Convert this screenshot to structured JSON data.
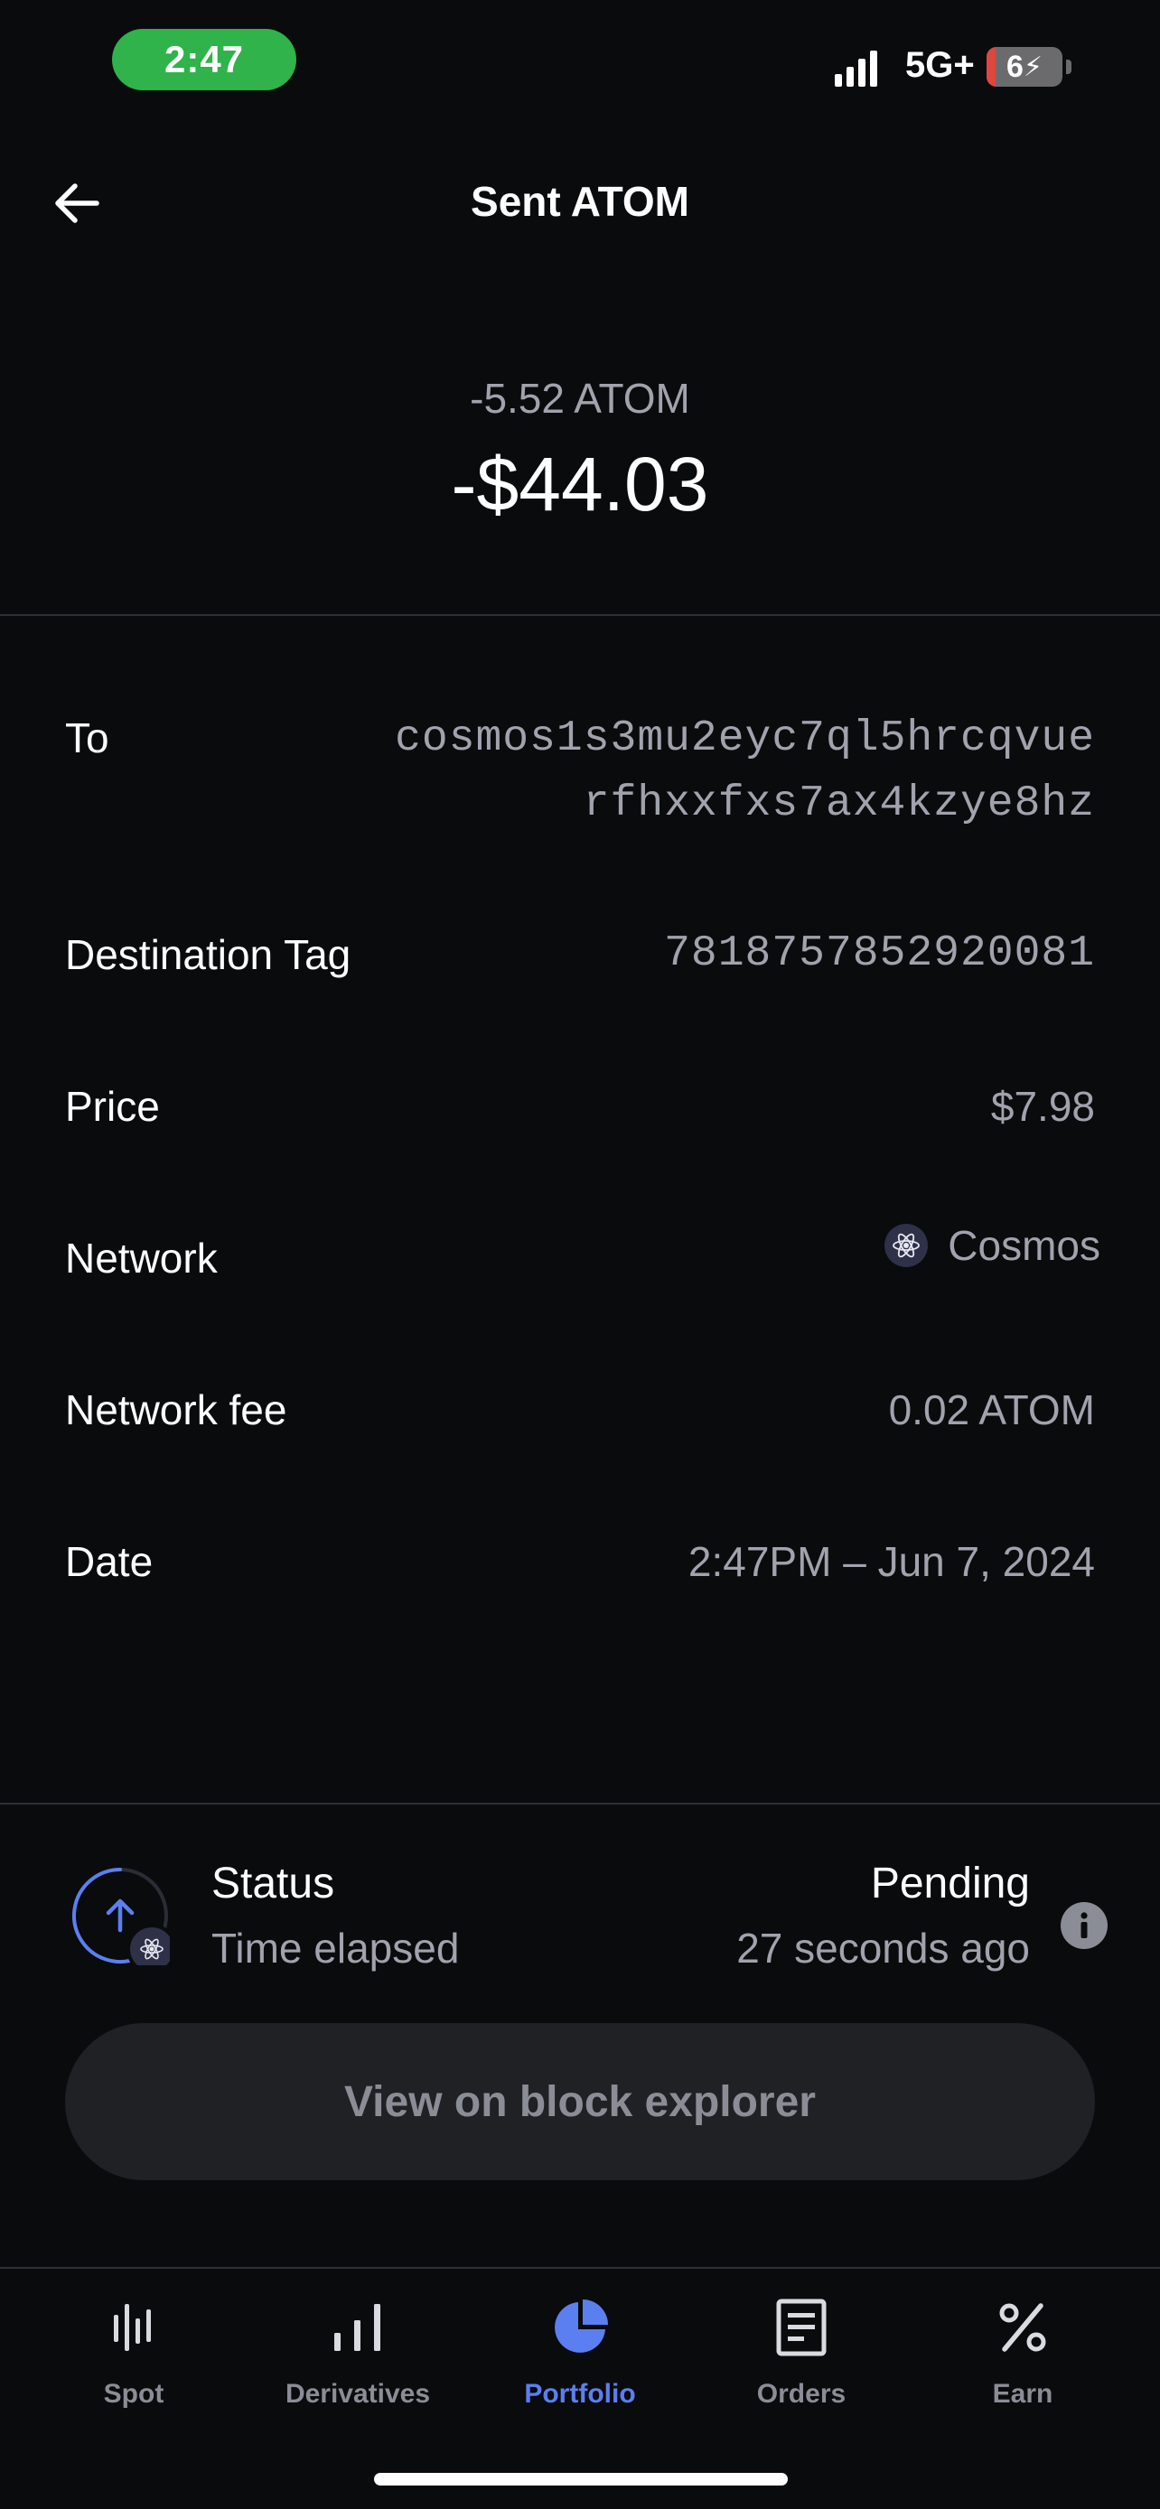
{
  "status_bar": {
    "time": "2:47",
    "network": "5G+",
    "battery": "6"
  },
  "header": {
    "title": "Sent ATOM",
    "back_icon": "arrow-left-icon"
  },
  "amount": {
    "crypto": "-5.52 ATOM",
    "fiat": "-$44.03"
  },
  "details": {
    "to_label": "To",
    "to_line1": "cosmos1s3mu2eyc7ql5hrcqvue",
    "to_line2": "rfhxxfxs7ax4kzye8hz",
    "dest_tag_label": "Destination Tag",
    "dest_tag_value": "7818757852920081",
    "price_label": "Price",
    "price_value": "$7.98",
    "network_label": "Network",
    "network_value": "Cosmos",
    "network_icon": "cosmos-atom-icon",
    "fee_label": "Network fee",
    "fee_value": "0.02 ATOM",
    "date_label": "Date",
    "date_value": "2:47PM – Jun 7, 2024"
  },
  "status": {
    "label": "Status",
    "value": "Pending",
    "sub_label": "Time elapsed",
    "sub_value": "27 seconds ago",
    "info_icon": "info-icon"
  },
  "explorer_button": "View on block explorer",
  "tabs": [
    {
      "label": "Spot",
      "icon": "candlestick-icon"
    },
    {
      "label": "Derivatives",
      "icon": "bar-chart-icon"
    },
    {
      "label": "Portfolio",
      "icon": "pie-chart-icon",
      "active": true
    },
    {
      "label": "Orders",
      "icon": "document-icon"
    },
    {
      "label": "Earn",
      "icon": "percent-icon"
    }
  ],
  "colors": {
    "background": "#0a0b0d",
    "accent": "#5b7ff0",
    "time_pill": "#2fb34a",
    "muted": "#a0a3ad"
  }
}
